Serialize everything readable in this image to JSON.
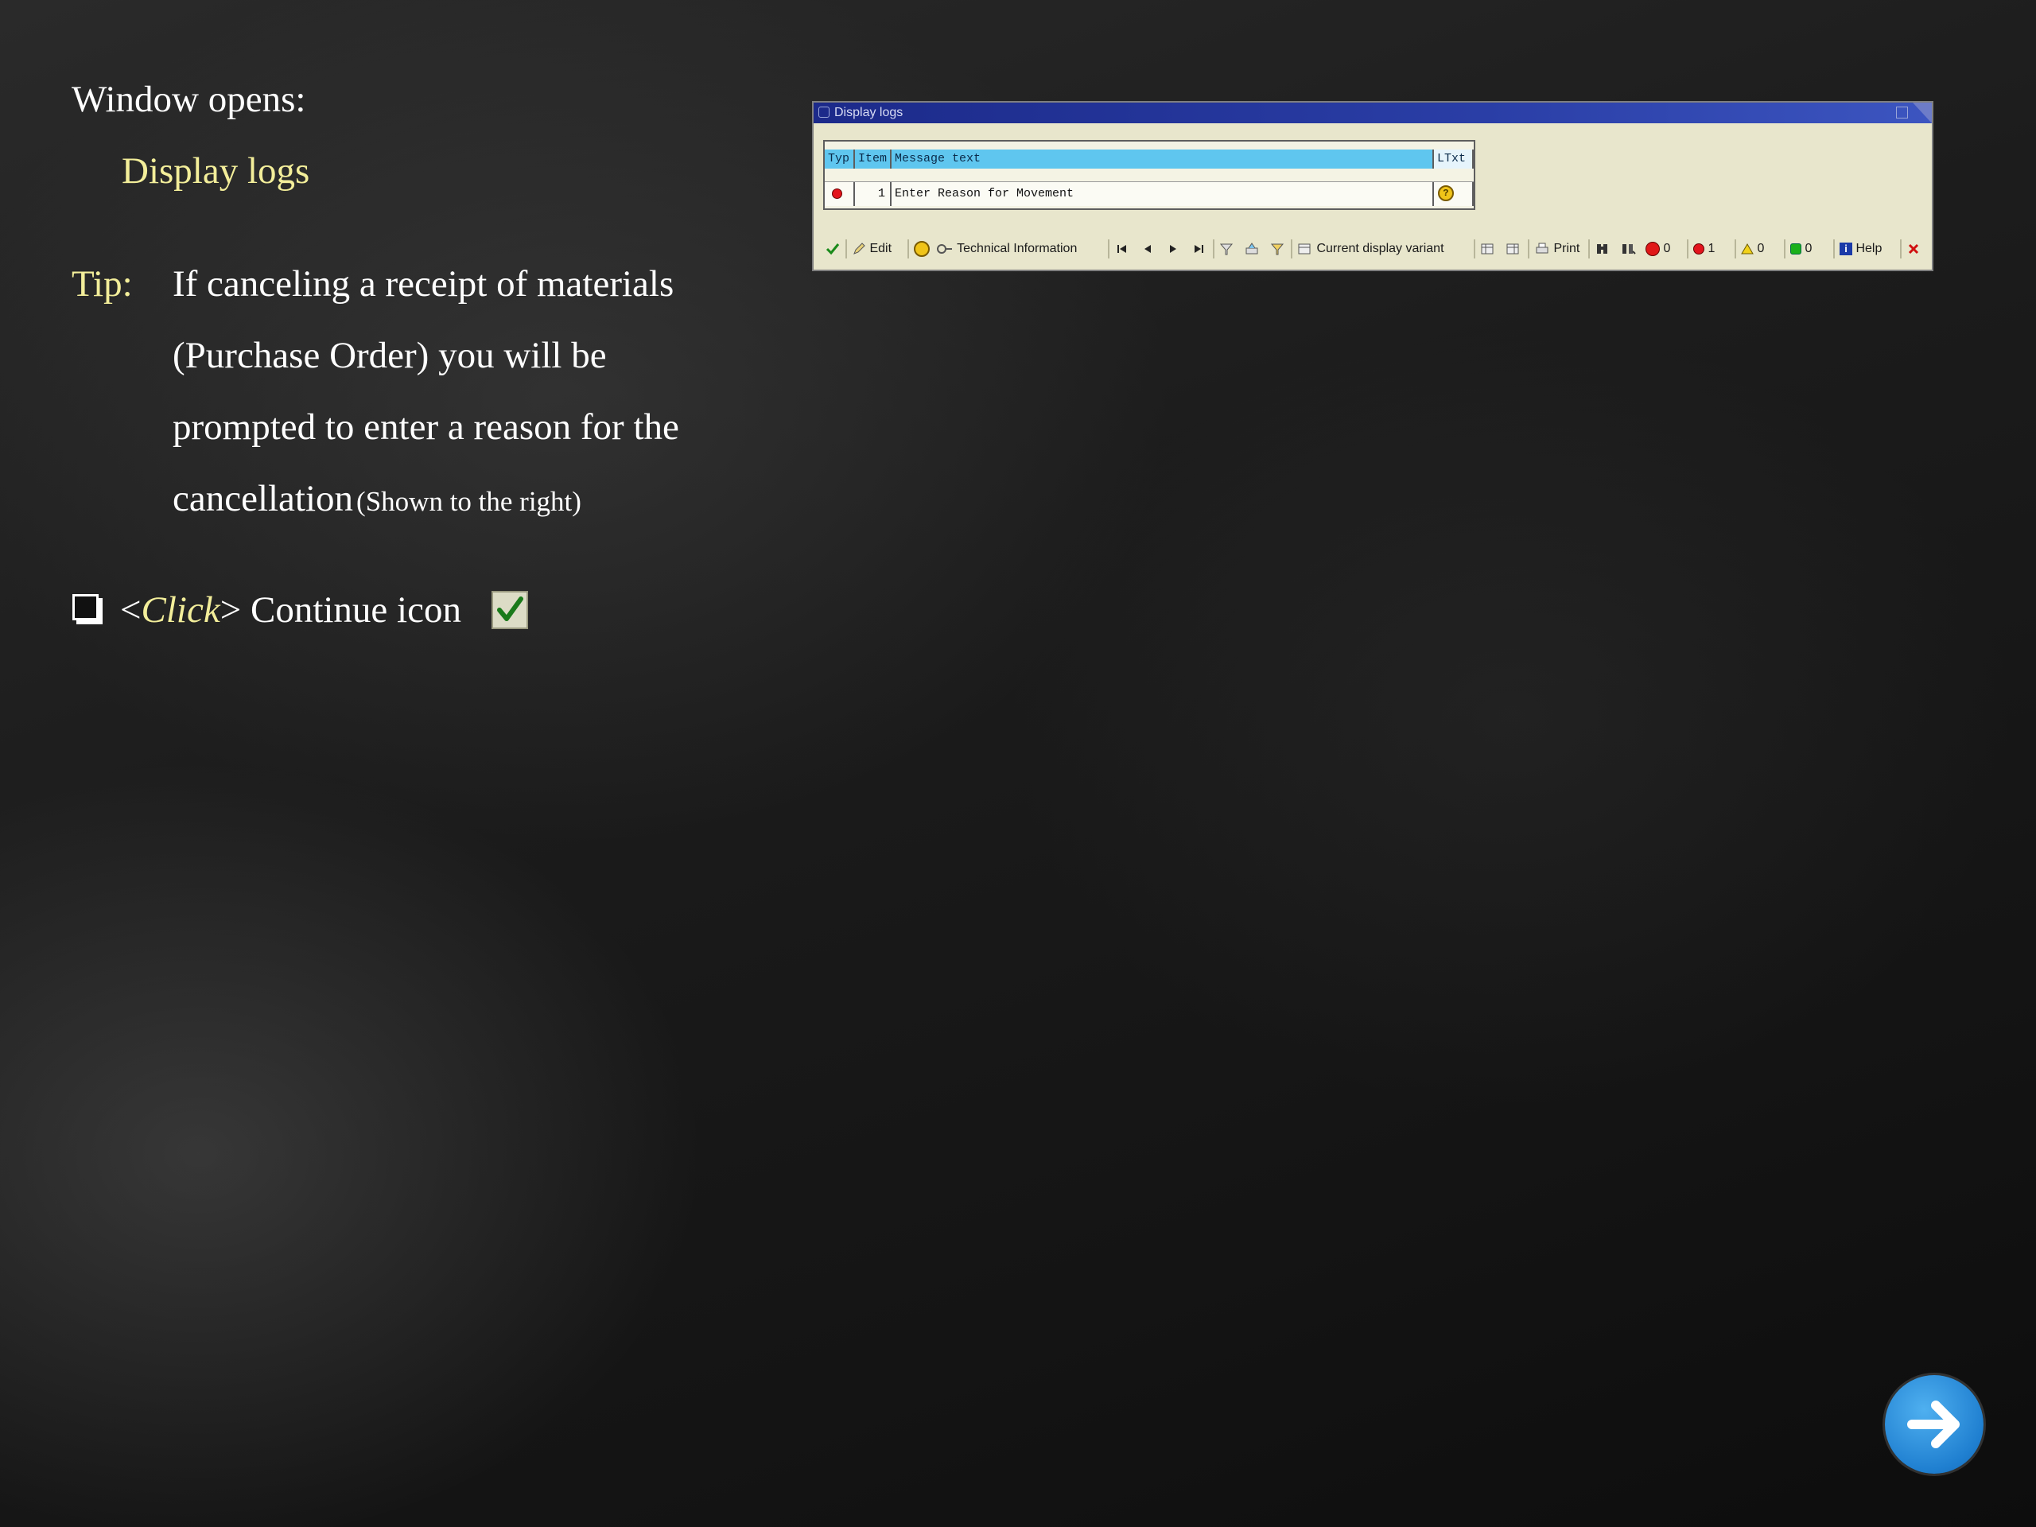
{
  "instructions": {
    "window_opens": "Window opens:",
    "window_name": "Display logs",
    "tip_label": "Tip:",
    "tip_lines": [
      "If canceling a receipt of materials",
      "(Purchase Order) you will be",
      "prompted to enter a reason for the",
      "cancellation"
    ],
    "tip_note": "(Shown to the right)",
    "step_open": "<",
    "step_click": "Click",
    "step_close": ">",
    "step_text": "Continue icon"
  },
  "dialog": {
    "title": "Display logs",
    "columns": [
      "Typ",
      "Item",
      "Message text",
      "LTxt"
    ],
    "rows": [
      {
        "typ_icon": "error-red-icon",
        "item": "1",
        "message": "Enter Reason for Movement",
        "ltxt_icon": "long-text-icon"
      }
    ],
    "toolbar": {
      "edit": "Edit",
      "technical_information": "Technical Information",
      "current_display_variant": "Current display variant",
      "print": "Print",
      "stop_count": "0",
      "error_count": "1",
      "warning_count": "0",
      "success_count": "0",
      "help": "Help"
    }
  },
  "colors": {
    "accent_yellow": "#f3ee9a",
    "sap_header_blue": "#5fc6ef",
    "sap_title_blue": "#1c2a8a",
    "next_button_blue": "#1f7fd0"
  },
  "icons": {
    "next": "arrow-right-icon",
    "continue": "checkmark-icon"
  }
}
